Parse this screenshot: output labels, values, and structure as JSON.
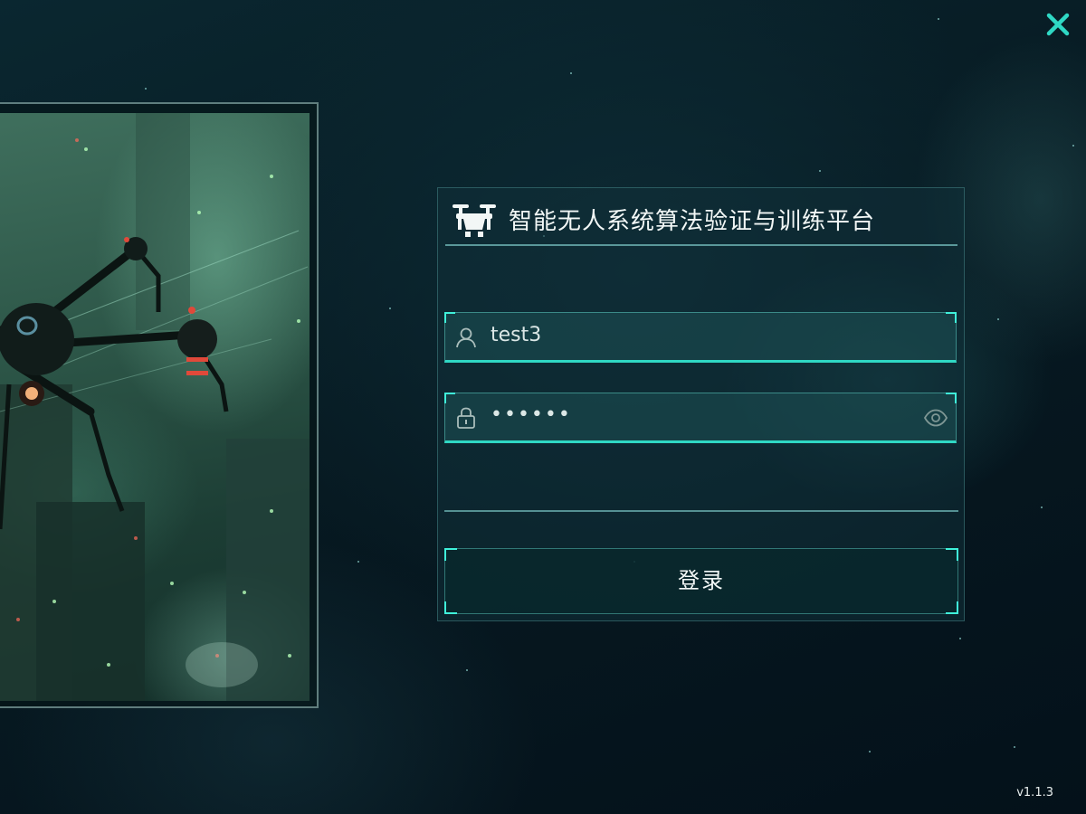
{
  "app": {
    "title": "智能无人系统算法验证与训练平台",
    "version": "v1.1.3",
    "accent_color": "#2fd8c4"
  },
  "header": {
    "logo_icon": "drone-icon",
    "close_icon": "close-icon"
  },
  "login": {
    "username": {
      "icon": "user-icon",
      "value": "test3"
    },
    "password": {
      "icon": "lock-icon",
      "value": "••••••",
      "toggle_icon": "eye-icon"
    },
    "submit_label": "登录"
  },
  "hero": {
    "image": "drone-city-artwork"
  }
}
